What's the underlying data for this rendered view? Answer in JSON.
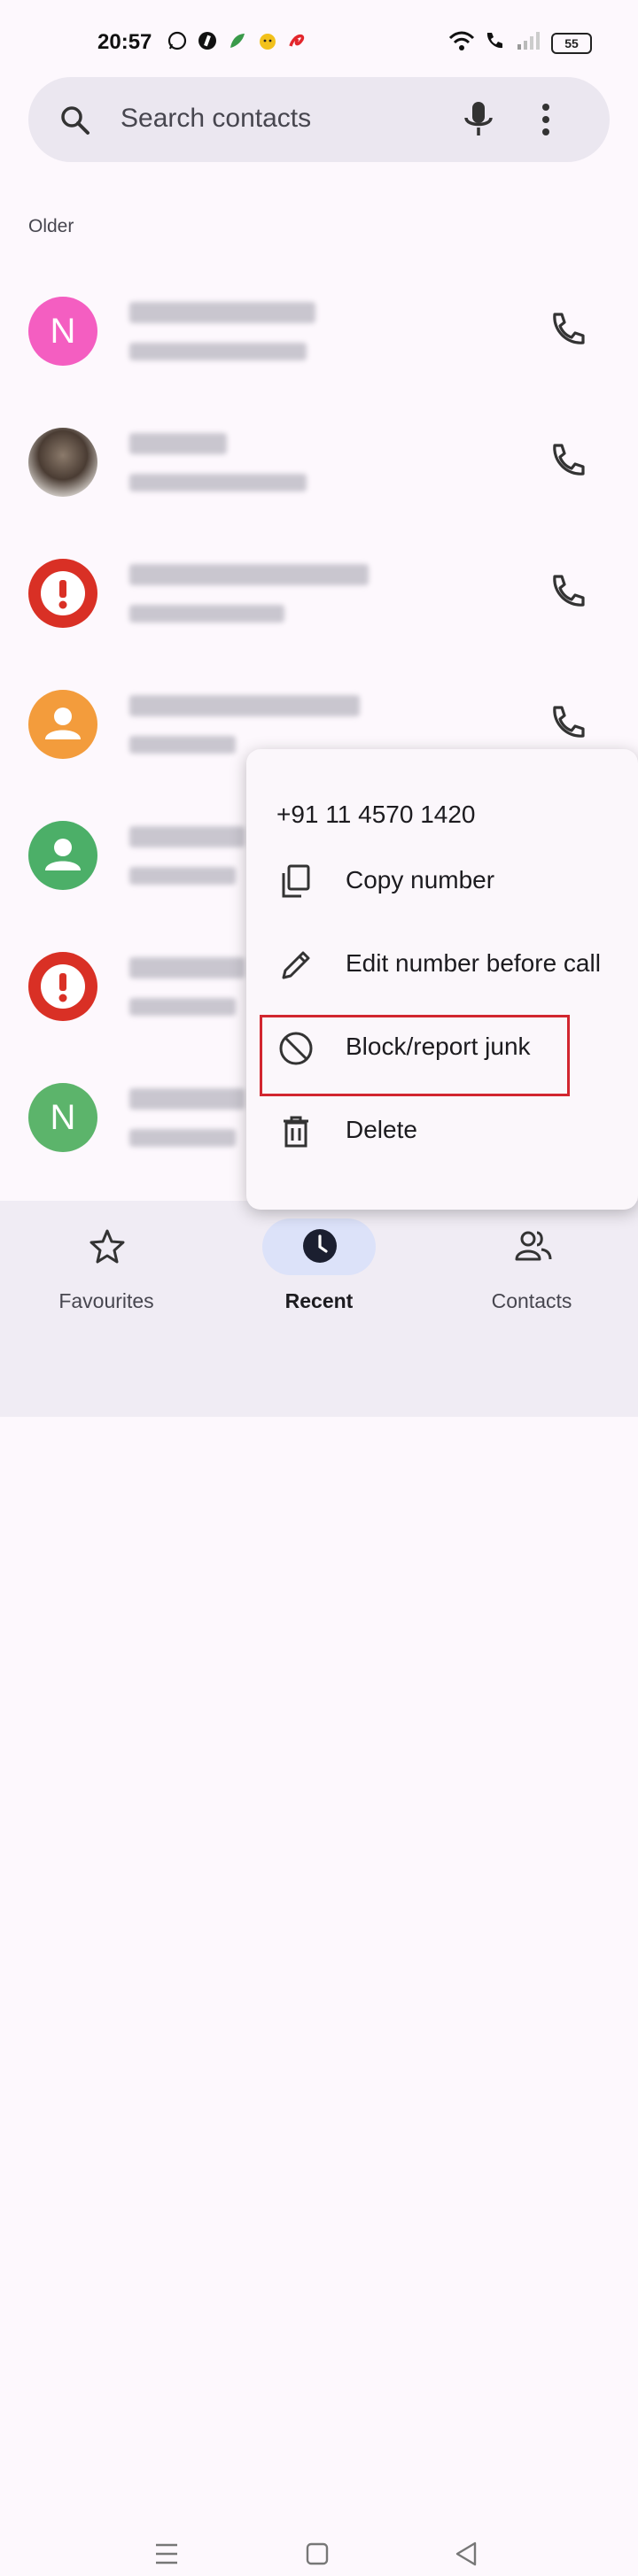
{
  "status_bar": {
    "time": "20:57",
    "app_icons": [
      "whatsapp-icon",
      "app-i-icon",
      "leaf-app-icon",
      "emoji-app-icon",
      "airtel-icon"
    ],
    "system_icons": [
      "wifi-icon",
      "wifi-call-icon",
      "signal-icon"
    ],
    "battery_level": "55"
  },
  "search": {
    "placeholder": "Search contacts",
    "icons": [
      "search-icon",
      "mic-icon",
      "more-vert-icon"
    ]
  },
  "section_title": "Older",
  "call_log": [
    {
      "avatar_letter": "N",
      "avatar_color": "#f45ec1",
      "redacted": true,
      "direction": "incoming"
    },
    {
      "avatar_letter": "",
      "avatar_type": "photo",
      "redacted": true,
      "direction": "outgoing"
    },
    {
      "avatar_letter": "",
      "avatar_type": "junk",
      "avatar_color": "#d93025",
      "redacted": true,
      "direction": "incoming"
    },
    {
      "avatar_letter": "",
      "avatar_type": "person",
      "avatar_color": "#f39c3c",
      "redacted": true,
      "direction": "outgoing"
    },
    {
      "avatar_letter": "",
      "avatar_type": "person",
      "avatar_color": "#4caf68",
      "redacted": true,
      "direction": "incoming"
    },
    {
      "avatar_letter": "",
      "avatar_type": "junk",
      "avatar_color": "#d93025",
      "redacted": true,
      "direction": "incoming"
    },
    {
      "avatar_letter": "N",
      "avatar_color": "#5cb46b",
      "redacted": true,
      "direction": "incoming"
    }
  ],
  "popup": {
    "number": "+91 11 4570 1420",
    "items": [
      {
        "label": "Copy number",
        "icon": "copy-icon"
      },
      {
        "label": "Edit number before call",
        "icon": "pencil-icon"
      },
      {
        "label": "Block/report junk",
        "icon": "block-icon"
      },
      {
        "label": "Delete",
        "icon": "trash-icon"
      }
    ]
  },
  "bottom_nav": {
    "favourites_label": "Favourites",
    "recent_label": "Recent",
    "contacts_label": "Contacts",
    "active": "Recent"
  },
  "colors": {
    "accent_pill": "#dce2f9",
    "highlight": "#d2262f"
  }
}
